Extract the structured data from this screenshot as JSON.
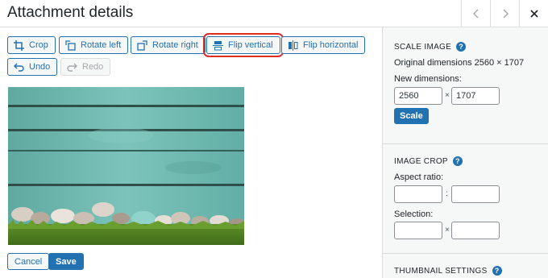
{
  "header": {
    "title": "Attachment details",
    "prev_icon": "chevron-left-icon",
    "next_icon": "chevron-right-icon",
    "close_icon": "close-icon"
  },
  "toolbar": {
    "crop": "Crop",
    "rotate_left": "Rotate left",
    "rotate_right": "Rotate right",
    "flip_vertical": "Flip vertical",
    "flip_horizontal": "Flip horizontal",
    "undo": "Undo",
    "redo": "Redo"
  },
  "actions": {
    "cancel": "Cancel",
    "save": "Save"
  },
  "scale_image": {
    "title": "Scale Image",
    "original": "Original dimensions 2560 × 1707",
    "new_label": "New dimensions:",
    "width": "2560",
    "height": "1707",
    "separator": "×",
    "button": "Scale"
  },
  "image_crop": {
    "title": "Image Crop",
    "aspect_label": "Aspect ratio:",
    "aspect_separator": ":",
    "selection_label": "Selection:",
    "selection_separator": "×"
  },
  "thumbnail": {
    "title": "Thumbnail Settings"
  },
  "colors": {
    "accent": "#2271b1",
    "highlight_outline": "#e02b27",
    "panel_bg": "#f6f7f7",
    "wood": "#6fb8b0"
  }
}
